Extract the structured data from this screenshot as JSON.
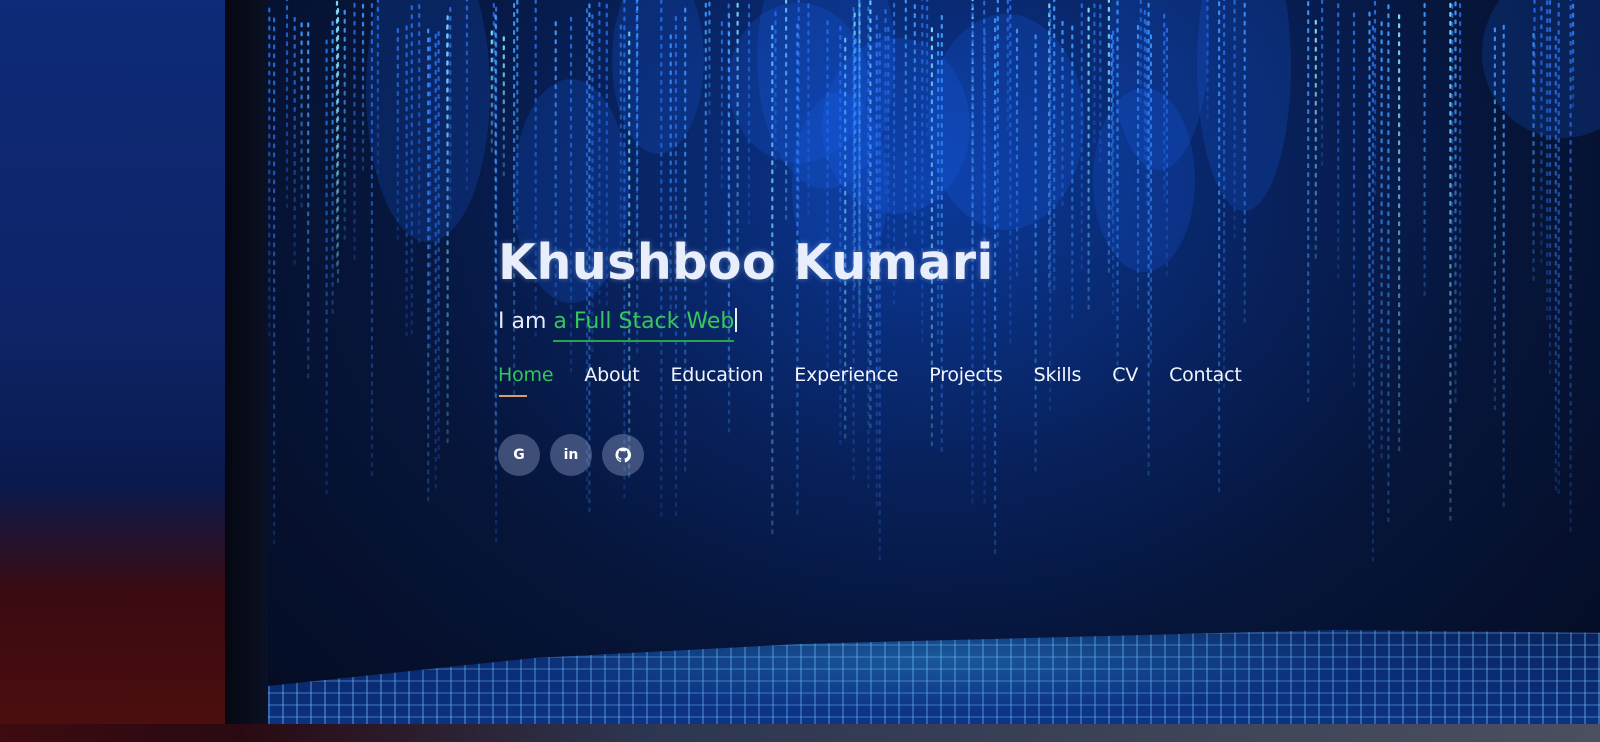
{
  "hero": {
    "name": "Khushboo Kumari",
    "tagline_prefix": "I am ",
    "tagline_typed": "a Full Stack Web"
  },
  "nav": {
    "items": [
      {
        "label": "Home",
        "active": true
      },
      {
        "label": "About",
        "active": false
      },
      {
        "label": "Education",
        "active": false
      },
      {
        "label": "Experience",
        "active": false
      },
      {
        "label": "Projects",
        "active": false
      },
      {
        "label": "Skills",
        "active": false
      },
      {
        "label": "CV",
        "active": false
      },
      {
        "label": "Contact",
        "active": false
      }
    ]
  },
  "social": {
    "google_glyph": "G",
    "linkedin_glyph": "in",
    "icons": [
      "google-icon",
      "linkedin-icon",
      "github-icon"
    ]
  },
  "colors": {
    "accent": "#33c65b",
    "text": "#f2f5ff",
    "background": "#06153a",
    "underline": "#d9a06a"
  }
}
